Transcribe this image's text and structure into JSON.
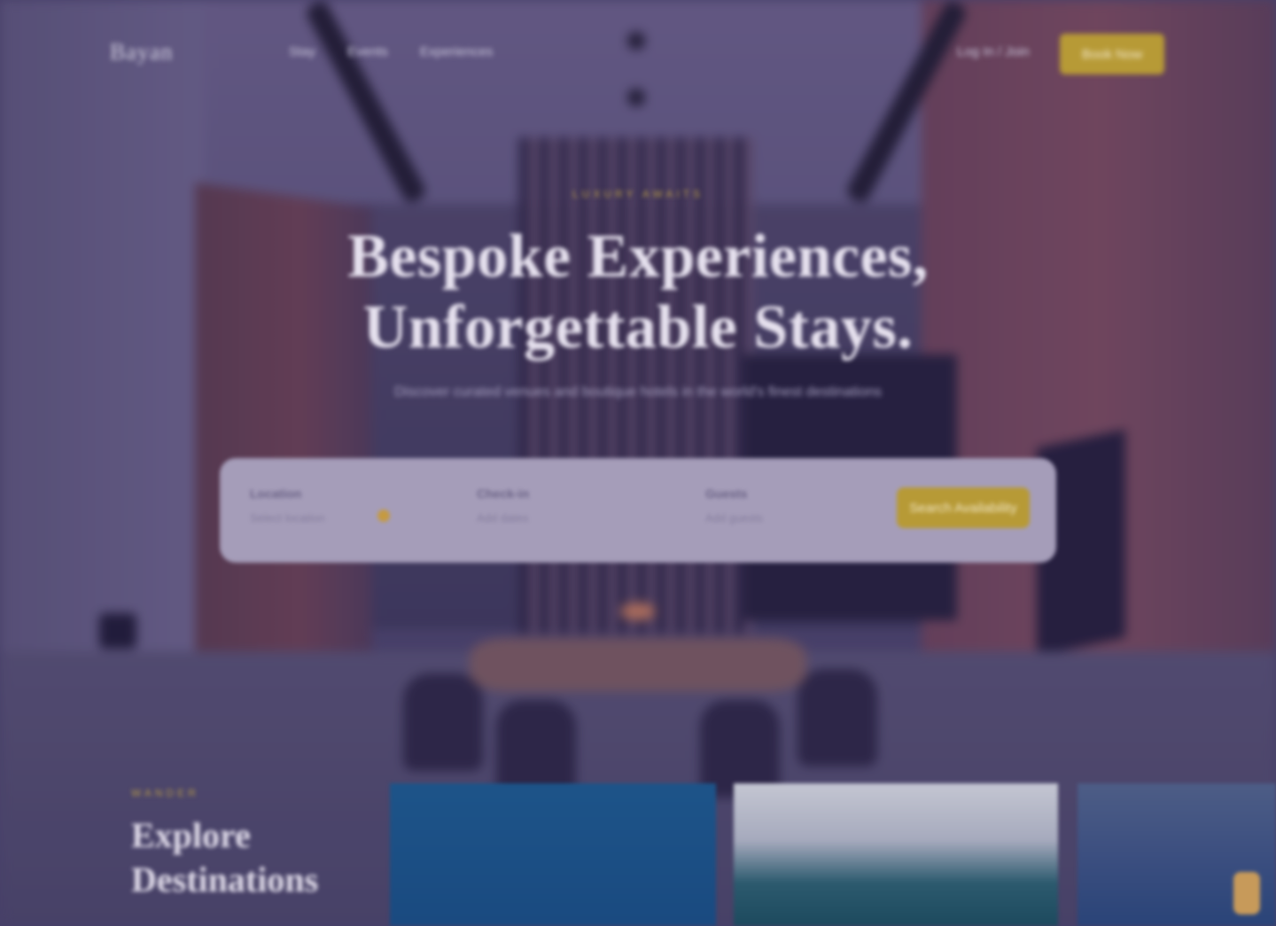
{
  "header": {
    "logo": "Bayan",
    "nav": [
      "Stay",
      "Events",
      "Experiences"
    ],
    "login": "Log In / Join",
    "cta": "Book Now"
  },
  "hero": {
    "eyebrow": "LUXURY AWAITS",
    "headline_line1": "Bespoke Experiences,",
    "headline_line2": "Unforgettable Stays.",
    "subtitle": "Discover curated venues and boutique hotels in the world's finest destinations"
  },
  "search": {
    "fields": [
      {
        "label": "Location",
        "value": "Select location"
      },
      {
        "label": "Check-in",
        "value": "Add dates"
      },
      {
        "label": "Guests",
        "value": "Add guests"
      }
    ],
    "button": "Search Availability"
  },
  "destinations": {
    "eyebrow": "WANDER",
    "title_line1": "Explore",
    "title_line2": "Destinations"
  }
}
